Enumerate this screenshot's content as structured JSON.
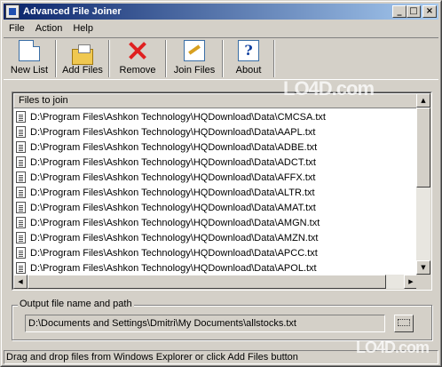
{
  "window": {
    "title": "Advanced File Joiner"
  },
  "titlebar_buttons": {
    "minimize": "_",
    "maximize": "□",
    "close": "×"
  },
  "menu": [
    "File",
    "Action",
    "Help"
  ],
  "toolbar": {
    "new_list": "New List",
    "add_files": "Add Files",
    "remove": "Remove",
    "join_files": "Join Files",
    "about": "About"
  },
  "files_list": {
    "header": "Files to join",
    "rows": [
      "D:\\Program Files\\Ashkon Technology\\HQDownload\\Data\\CMCSA.txt",
      "D:\\Program Files\\Ashkon Technology\\HQDownload\\Data\\AAPL.txt",
      "D:\\Program Files\\Ashkon Technology\\HQDownload\\Data\\ADBE.txt",
      "D:\\Program Files\\Ashkon Technology\\HQDownload\\Data\\ADCT.txt",
      "D:\\Program Files\\Ashkon Technology\\HQDownload\\Data\\AFFX.txt",
      "D:\\Program Files\\Ashkon Technology\\HQDownload\\Data\\ALTR.txt",
      "D:\\Program Files\\Ashkon Technology\\HQDownload\\Data\\AMAT.txt",
      "D:\\Program Files\\Ashkon Technology\\HQDownload\\Data\\AMGN.txt",
      "D:\\Program Files\\Ashkon Technology\\HQDownload\\Data\\AMZN.txt",
      "D:\\Program Files\\Ashkon Technology\\HQDownload\\Data\\APCC.txt",
      "D:\\Program Files\\Ashkon Technology\\HQDownload\\Data\\APOL.txt"
    ]
  },
  "output": {
    "label": "Output file name and path",
    "value": "D:\\Documents and Settings\\Dmitri\\My Documents\\allstocks.txt"
  },
  "status": "Drag and drop files from Windows Explorer or click Add Files button",
  "watermark": "LO4D.com"
}
